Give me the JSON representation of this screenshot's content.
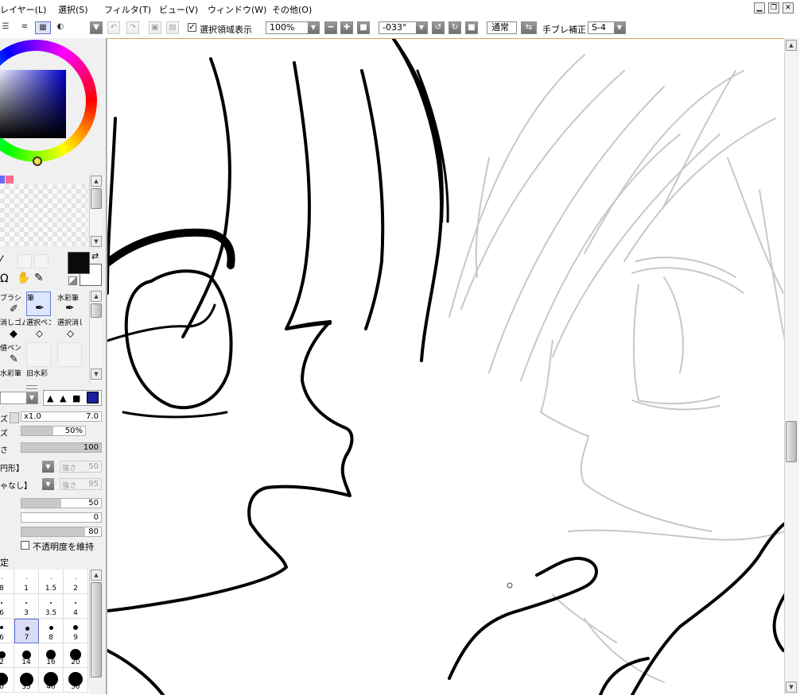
{
  "menu": {
    "layer": "レイヤー(L)",
    "select": "選択(S)",
    "filter": "フィルタ(T)",
    "view": "ビュー(V)",
    "window": "ウィンドウ(W)",
    "other": "その他(O)"
  },
  "toolbar": {
    "show_selection_label": "選択領域表示",
    "show_selection_checked": true,
    "zoom_value": "100%",
    "rotation_value": "-033°",
    "blend_mode": "通常",
    "stabilizer_label": "手ブレ補正",
    "stabilizer_value": "S-4"
  },
  "colors": {
    "primary": "#0a0a0a",
    "secondary": "#ffffff",
    "swatch_blue": "#6a6aff",
    "swatch_pink": "#ff6a8a",
    "wheel_square": "#0000a0"
  },
  "tools": [
    {
      "label": "ブラシ",
      "icon": "airbrush-icon",
      "selected": false
    },
    {
      "label": "筆",
      "icon": "brush-icon",
      "selected": true
    },
    {
      "label": "水彩筆",
      "icon": "watercolor-icon",
      "selected": false
    },
    {
      "label": "消しゴム",
      "icon": "eraser-icon",
      "selected": false
    },
    {
      "label": "選択ペン",
      "icon": "select-pen-icon",
      "selected": false
    },
    {
      "label": "選択消し",
      "icon": "select-eraser-icon",
      "selected": false
    },
    {
      "label": "値ペン",
      "icon": "pen-icon",
      "selected": false
    },
    {
      "label": "",
      "icon": "",
      "selected": false
    },
    {
      "label": "",
      "icon": "",
      "selected": false
    },
    {
      "label": "水彩筆",
      "icon": "",
      "selected": false
    },
    {
      "label": "旧水彩",
      "icon": "",
      "selected": false
    },
    {
      "label": "",
      "icon": "",
      "selected": false
    }
  ],
  "brush": {
    "size_label": "ズ",
    "size_multiplier": "x1.0",
    "size_value": "7.0",
    "density_label": "ズ",
    "density_value": "50%",
    "density_fraction": 0.5,
    "third_label": "さ",
    "third_value": "100",
    "third_fraction": 1.0,
    "shape_label": "円形】",
    "shape_strength_label": "強さ",
    "shape_strength_value": "50",
    "texture_label": "ゃなし】",
    "texture_strength_label": "強さ",
    "texture_strength_value": "95",
    "blend_value": "50",
    "blend_fraction": 0.5,
    "dilution_value": "0",
    "dilution_fraction": 0.0,
    "persistence_value": "80",
    "persistence_fraction": 0.8,
    "keep_opacity_label": "不透明度を維持",
    "keep_opacity_checked": false,
    "settings_label": "定"
  },
  "brush_sizes": [
    [
      "8",
      "1",
      "1.5",
      "2"
    ],
    [
      "6",
      "3",
      "3.5",
      "4"
    ],
    [
      "6",
      "7",
      "8",
      "9"
    ],
    [
      "2",
      "14",
      "16",
      "20"
    ],
    [
      "0",
      "35",
      "40",
      "50"
    ]
  ],
  "selected_brush_size": "7"
}
